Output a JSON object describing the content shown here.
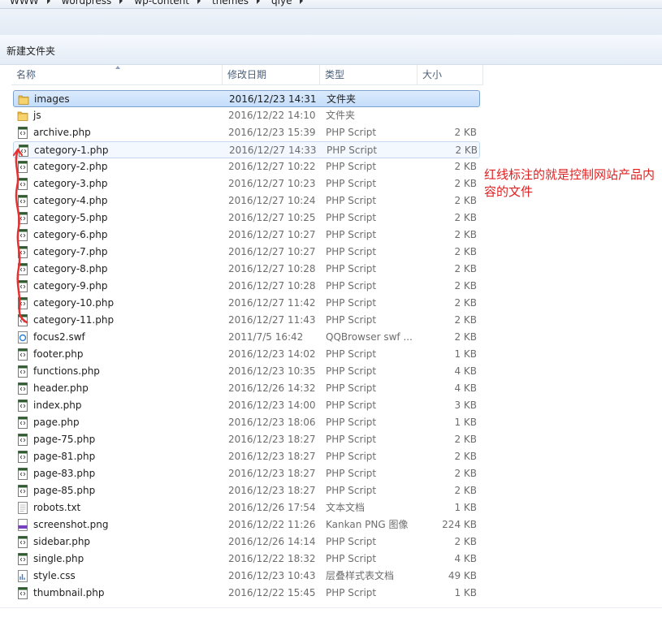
{
  "breadcrumb": [
    "WWW",
    "wordpress",
    "wp-content",
    "themes",
    "qiye"
  ],
  "toolbar": {
    "new_folder": "新建文件夹"
  },
  "columns": {
    "name": "名称",
    "date": "修改日期",
    "type": "类型",
    "size": "大小"
  },
  "annotation": "红线标注的就是控制网站产品内容的文件",
  "colors": {
    "annotation": "#e02020",
    "selection": "#c4ddfa"
  },
  "files": [
    {
      "name": "images",
      "date": "2016/12/23 14:31",
      "type": "文件夹",
      "size": "",
      "icon": "folder-icon",
      "state": "selected"
    },
    {
      "name": "js",
      "date": "2016/12/22 14:10",
      "type": "文件夹",
      "size": "",
      "icon": "folder-icon"
    },
    {
      "name": "archive.php",
      "date": "2016/12/23 15:39",
      "type": "PHP Script",
      "size": "2 KB",
      "icon": "php-file-icon"
    },
    {
      "name": "category-1.php",
      "date": "2016/12/27 14:33",
      "type": "PHP Script",
      "size": "2 KB",
      "icon": "php-file-icon",
      "state": "hover"
    },
    {
      "name": "category-2.php",
      "date": "2016/12/27 10:22",
      "type": "PHP Script",
      "size": "2 KB",
      "icon": "php-file-icon"
    },
    {
      "name": "category-3.php",
      "date": "2016/12/27 10:23",
      "type": "PHP Script",
      "size": "2 KB",
      "icon": "php-file-icon"
    },
    {
      "name": "category-4.php",
      "date": "2016/12/27 10:24",
      "type": "PHP Script",
      "size": "2 KB",
      "icon": "php-file-icon"
    },
    {
      "name": "category-5.php",
      "date": "2016/12/27 10:25",
      "type": "PHP Script",
      "size": "2 KB",
      "icon": "php-file-icon"
    },
    {
      "name": "category-6.php",
      "date": "2016/12/27 10:27",
      "type": "PHP Script",
      "size": "2 KB",
      "icon": "php-file-icon"
    },
    {
      "name": "category-7.php",
      "date": "2016/12/27 10:27",
      "type": "PHP Script",
      "size": "2 KB",
      "icon": "php-file-icon"
    },
    {
      "name": "category-8.php",
      "date": "2016/12/27 10:28",
      "type": "PHP Script",
      "size": "2 KB",
      "icon": "php-file-icon"
    },
    {
      "name": "category-9.php",
      "date": "2016/12/27 10:28",
      "type": "PHP Script",
      "size": "2 KB",
      "icon": "php-file-icon"
    },
    {
      "name": "category-10.php",
      "date": "2016/12/27 11:42",
      "type": "PHP Script",
      "size": "2 KB",
      "icon": "php-file-icon"
    },
    {
      "name": "category-11.php",
      "date": "2016/12/27 11:43",
      "type": "PHP Script",
      "size": "2 KB",
      "icon": "php-file-icon"
    },
    {
      "name": "focus2.swf",
      "date": "2011/7/5 16:42",
      "type": "QQBrowser swf ...",
      "size": "2 KB",
      "icon": "swf-file-icon"
    },
    {
      "name": "footer.php",
      "date": "2016/12/23 14:02",
      "type": "PHP Script",
      "size": "1 KB",
      "icon": "php-file-icon"
    },
    {
      "name": "functions.php",
      "date": "2016/12/23 10:35",
      "type": "PHP Script",
      "size": "4 KB",
      "icon": "php-file-icon"
    },
    {
      "name": "header.php",
      "date": "2016/12/26 14:32",
      "type": "PHP Script",
      "size": "4 KB",
      "icon": "php-file-icon"
    },
    {
      "name": "index.php",
      "date": "2016/12/23 14:00",
      "type": "PHP Script",
      "size": "3 KB",
      "icon": "php-file-icon"
    },
    {
      "name": "page.php",
      "date": "2016/12/23 18:06",
      "type": "PHP Script",
      "size": "1 KB",
      "icon": "php-file-icon"
    },
    {
      "name": "page-75.php",
      "date": "2016/12/23 18:27",
      "type": "PHP Script",
      "size": "2 KB",
      "icon": "php-file-icon"
    },
    {
      "name": "page-81.php",
      "date": "2016/12/23 18:27",
      "type": "PHP Script",
      "size": "2 KB",
      "icon": "php-file-icon"
    },
    {
      "name": "page-83.php",
      "date": "2016/12/23 18:27",
      "type": "PHP Script",
      "size": "2 KB",
      "icon": "php-file-icon"
    },
    {
      "name": "page-85.php",
      "date": "2016/12/23 18:27",
      "type": "PHP Script",
      "size": "2 KB",
      "icon": "php-file-icon"
    },
    {
      "name": "robots.txt",
      "date": "2016/12/26 17:54",
      "type": "文本文档",
      "size": "1 KB",
      "icon": "text-file-icon"
    },
    {
      "name": "screenshot.png",
      "date": "2016/12/22 11:26",
      "type": "Kankan PNG 图像",
      "size": "224 KB",
      "icon": "png-file-icon"
    },
    {
      "name": "sidebar.php",
      "date": "2016/12/26 14:14",
      "type": "PHP Script",
      "size": "2 KB",
      "icon": "php-file-icon"
    },
    {
      "name": "single.php",
      "date": "2016/12/22 18:32",
      "type": "PHP Script",
      "size": "4 KB",
      "icon": "php-file-icon"
    },
    {
      "name": "style.css",
      "date": "2016/12/23 10:43",
      "type": "层叠样式表文档",
      "size": "49 KB",
      "icon": "css-file-icon"
    },
    {
      "name": "thumbnail.php",
      "date": "2016/12/22 15:45",
      "type": "PHP Script",
      "size": "1 KB",
      "icon": "php-file-icon"
    }
  ]
}
